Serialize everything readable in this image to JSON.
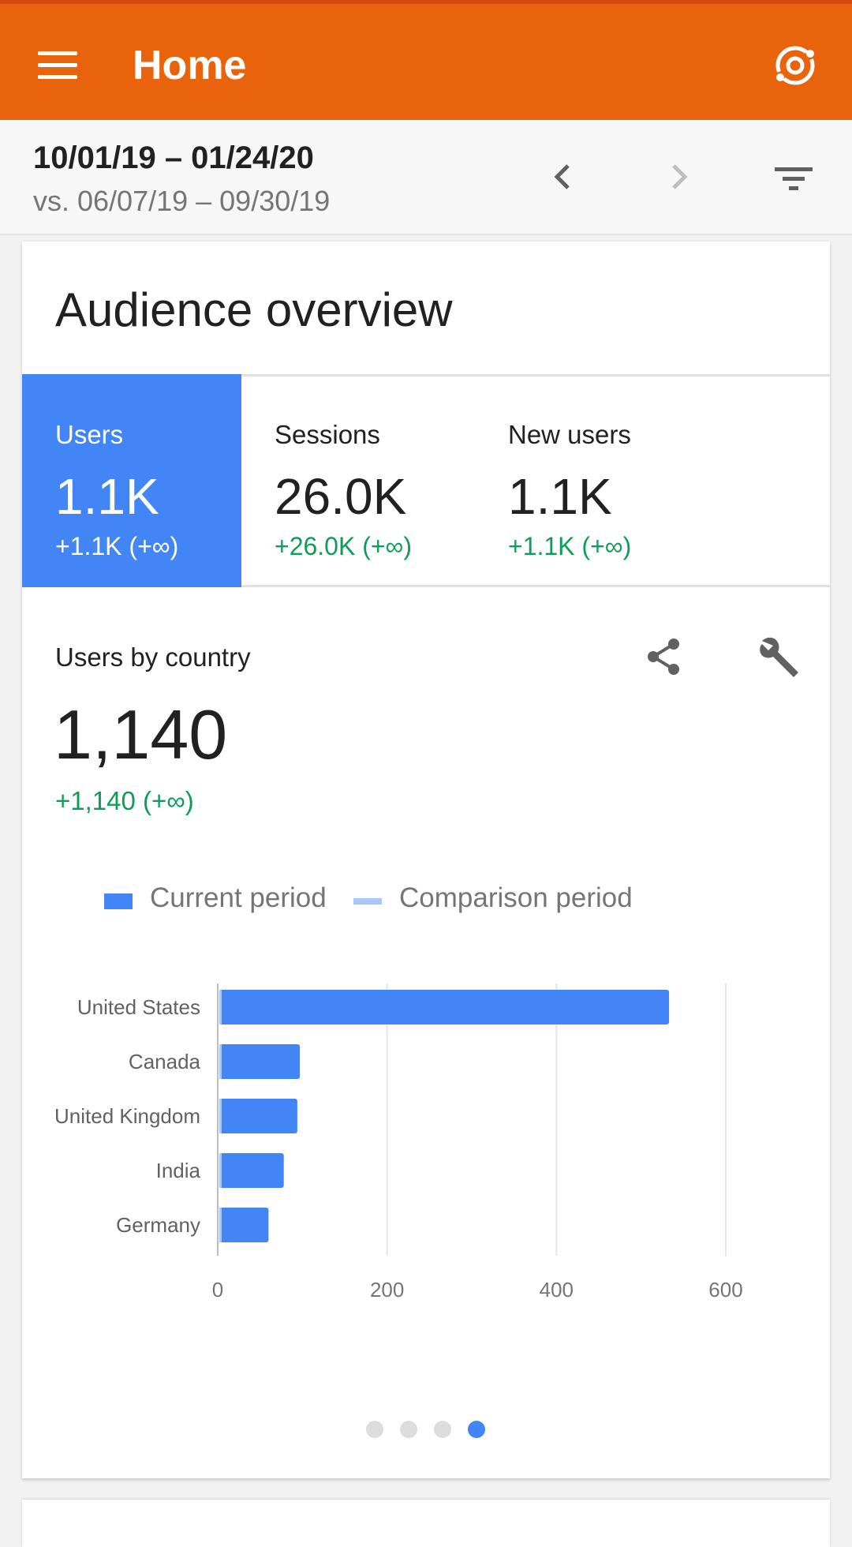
{
  "appbar": {
    "title": "Home",
    "menu_icon": "hamburger-menu-icon",
    "sync_icon": "sync-account-icon",
    "color": "#e8630b"
  },
  "datebar": {
    "date_range": "10/01/19 – 01/24/20",
    "compare_range": "vs. 06/07/19 – 09/30/19",
    "prev_icon": "chevron-left-icon",
    "next_icon": "chevron-right-icon",
    "filter_icon": "filter-icon"
  },
  "card": {
    "title": "Audience overview",
    "tabs": [
      {
        "label": "Users",
        "value": "1.1K",
        "delta": "+1.1K (+∞)",
        "active": true
      },
      {
        "label": "Sessions",
        "value": "26.0K",
        "delta": "+26.0K (+∞)",
        "active": false
      },
      {
        "label": "New users",
        "value": "1.1K",
        "delta": "+1.1K (+∞)",
        "active": false
      }
    ],
    "metric": {
      "label": "Users by country",
      "value": "1,140",
      "delta": "+1,140 (+∞)"
    },
    "legend": {
      "current": "Current period",
      "comparison": "Comparison period",
      "current_color": "#4285f4",
      "comparison_color": "#a8c7fa"
    },
    "pagination": {
      "total": 4,
      "active": 4
    }
  },
  "chart_data": {
    "type": "bar",
    "orientation": "horizontal",
    "categories": [
      "United States",
      "Canada",
      "United Kingdom",
      "India",
      "Germany"
    ],
    "series": [
      {
        "name": "Current period",
        "values": [
          533,
          97,
          94,
          78,
          60
        ],
        "color": "#4285f4"
      },
      {
        "name": "Comparison period",
        "values": [
          0,
          0,
          0,
          0,
          0
        ],
        "color": "#a8c7fa"
      }
    ],
    "xlim": [
      0,
      600
    ],
    "xticks": [
      0,
      200,
      400,
      600
    ],
    "grid": true,
    "legend_position": "top"
  }
}
